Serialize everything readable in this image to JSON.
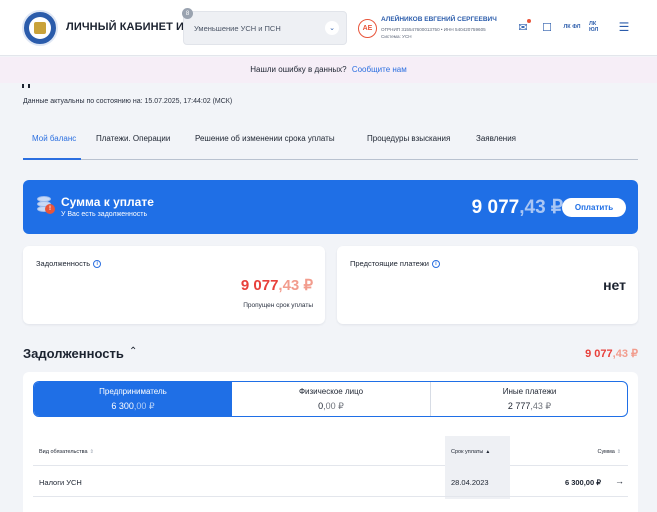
{
  "header": {
    "cabinet_title": "ЛИЧНЫЙ КАБИНЕТ ИП",
    "regime_badge": "8",
    "regime_value": "Уменьшение УСН и ПСН",
    "avatar_initials": "АЕ",
    "user_name": "АЛЕЙНИКОВ ЕВГЕНИЙ СЕРГЕЕВИЧ",
    "user_meta": "ОГРНИП 315547600013750 • ИНН 540420759605",
    "user_system": "Система: УСН",
    "lk_fl": "ЛК ФЛ",
    "lk_yl": "ЛК ЮЛ"
  },
  "error_banner": {
    "text": "Нашли ошибку в данных?",
    "link": "Сообщите нам"
  },
  "actual_date": "Данные актуальны по состоянию на: 15.07.2025, 17:44:02 (МСК)",
  "tabs": [
    {
      "label": "Мой баланс",
      "active": true
    },
    {
      "label": "Платежи. Операции"
    },
    {
      "label": "Решение об изменении срока уплаты"
    },
    {
      "label": "Процедуры взыскания"
    },
    {
      "label": "Заявления"
    }
  ],
  "pay_banner": {
    "title": "Сумма к уплате",
    "subtitle": "У Вас есть задолженность",
    "amount_rub": "9 077",
    "amount_kop": ",43 ₽",
    "button": "Оплатить"
  },
  "debt_card": {
    "label": "Задолженность",
    "amount_rub": "9 077",
    "amount_kop": ",43 ₽",
    "status": "Пропущен срок уплаты"
  },
  "upcoming_card": {
    "label": "Предстоящие платежи",
    "value": "нет"
  },
  "debt_section": {
    "title": "Задолженность",
    "amount_rub": "9 077",
    "amount_kop": ",43 ₽",
    "segments": [
      {
        "label": "Предприниматель",
        "rub": "6 300",
        "kop": ",00 ₽",
        "active": true
      },
      {
        "label": "Физическое лицо",
        "rub": "0",
        "kop": ",00 ₽"
      },
      {
        "label": "Иные платежи",
        "rub": "2 777",
        "kop": ",43 ₽"
      }
    ],
    "table": {
      "columns": [
        "Вид обязательства",
        "Срок уплаты",
        "Сумма"
      ],
      "rows": [
        {
          "kind": "Налоги УСН",
          "date": "28.04.2023",
          "sum": "6 300,00 ₽"
        }
      ]
    }
  },
  "colors": {
    "accent": "#1f6fe6",
    "debt_red": "#e8403b",
    "error_banner_bg": "#f6eef7"
  }
}
